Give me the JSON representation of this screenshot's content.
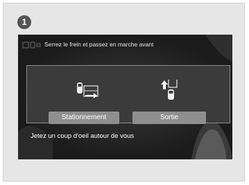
{
  "step": {
    "number": "1"
  },
  "screen": {
    "top_message": "Serrez le frein et passez en marche avant",
    "bottom_message": "Jetez un coup d'oeil autour de vous"
  },
  "options": [
    {
      "label": "Stationnement",
      "icon": "parking-in-icon"
    },
    {
      "label": "Sortie",
      "icon": "exit-parking-icon"
    }
  ],
  "colors": {
    "screen_bg": "#1b1b1b",
    "panel_bg": "#3b3b3b",
    "button_bg": "#8f8f8f",
    "badge_bg": "#555555"
  }
}
